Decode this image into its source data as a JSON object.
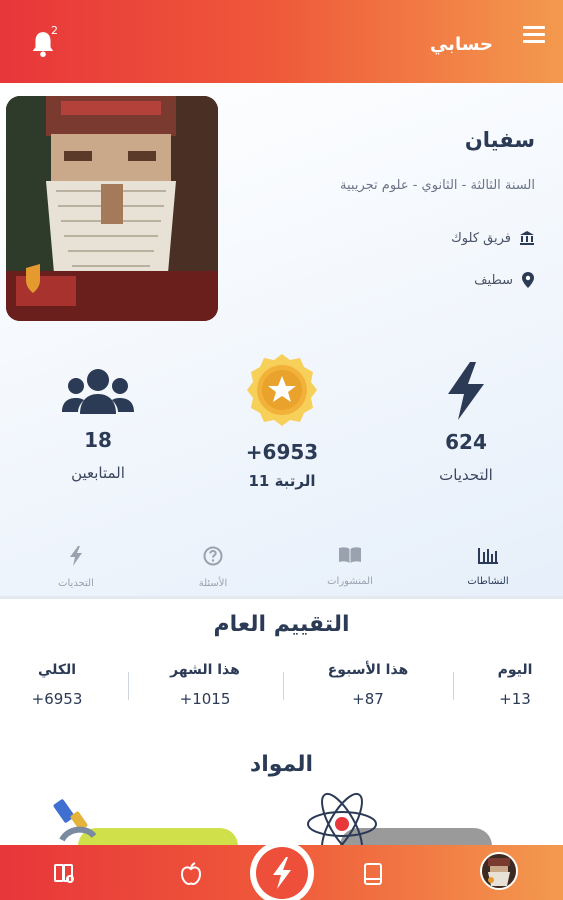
{
  "header": {
    "title": "حسابي",
    "notification_count": "2"
  },
  "profile": {
    "name": "سفيان",
    "level": "السنة الثالثة - الثانوي - علوم تجريبية",
    "team": "فريق كلوك",
    "city": "سطيف"
  },
  "stats": {
    "followers": {
      "value": "18",
      "label": "المتابعين"
    },
    "points": {
      "value": "+6953",
      "label": "الرتبة 11"
    },
    "challenges": {
      "value": "624",
      "label": "التحديات"
    }
  },
  "tabs": [
    {
      "label": "النشاطات",
      "icon": "bar-chart-icon",
      "active": true
    },
    {
      "label": "المنشورات",
      "icon": "book-open-icon",
      "active": false
    },
    {
      "label": "الأسئلة",
      "icon": "question-icon",
      "active": false
    },
    {
      "label": "التحديات",
      "icon": "lightning-icon",
      "active": false
    }
  ],
  "rating": {
    "title": "التقييم العام",
    "columns": [
      {
        "label": "اليوم",
        "value": "+13"
      },
      {
        "label": "هذا الأسبوع",
        "value": "+87"
      },
      {
        "label": "هذا الشهر",
        "value": "+1015"
      },
      {
        "label": "الكلي",
        "value": "+6953"
      }
    ]
  },
  "subjects": {
    "title": "المواد"
  },
  "colors": {
    "accent_start": "#e8363a",
    "accent_end": "#f39a4e",
    "text_dark": "#2b3a55",
    "medal_gold": "#f2b23a"
  }
}
